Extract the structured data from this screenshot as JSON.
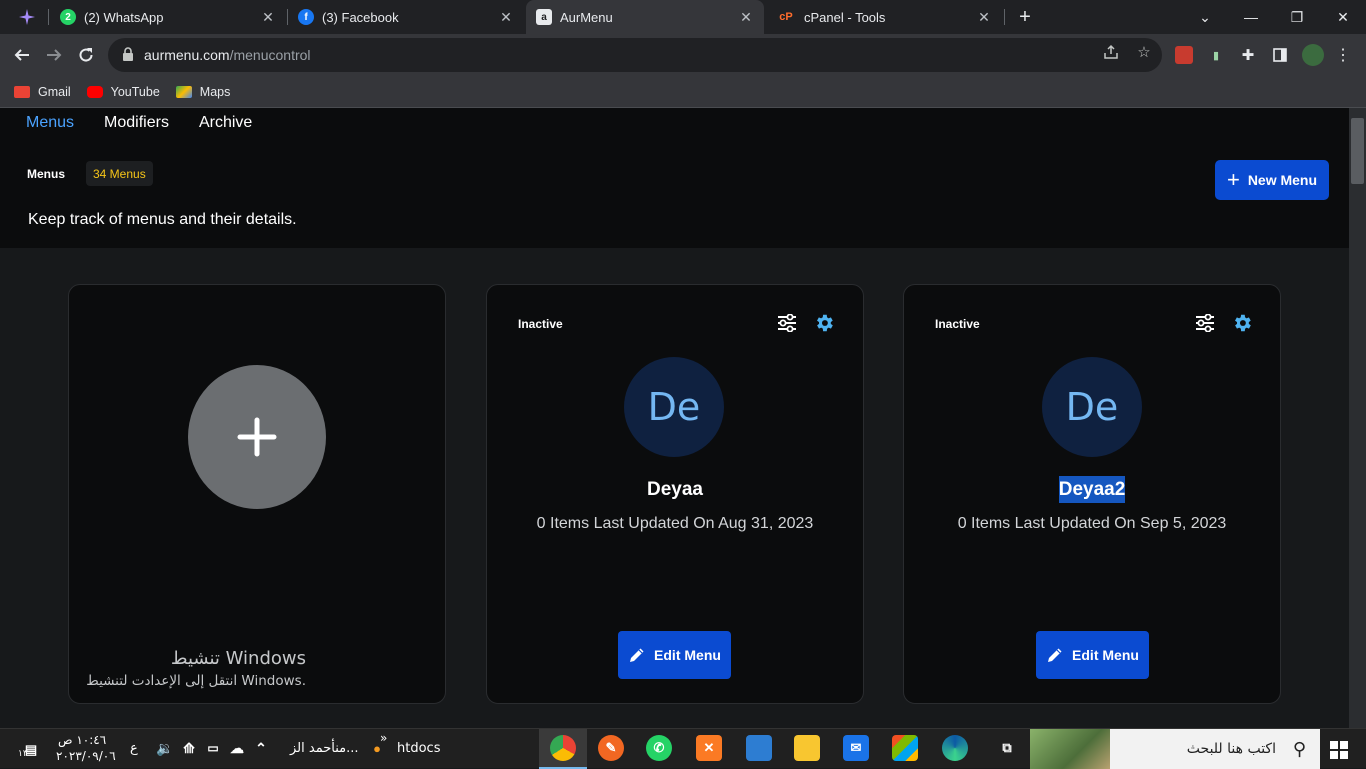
{
  "browser": {
    "tabs": [
      {
        "title": "(2) WhatsApp",
        "color": "#25d366",
        "icon": "whatsapp-icon",
        "badge": "2"
      },
      {
        "title": "(3) Facebook",
        "color": "#1877f2",
        "icon": "facebook-icon",
        "badge": "f"
      },
      {
        "title": "AurMenu",
        "color": "#e8eaed",
        "icon": "aurmenu-icon",
        "badge": "a"
      },
      {
        "title": "cPanel - Tools",
        "color": "#ff6c2c",
        "icon": "cpanel-icon",
        "badge": "cP"
      }
    ],
    "url_host": "aurmenu.com",
    "url_path": "/menucontrol",
    "bookmarks": [
      {
        "label": "Gmail",
        "color": "#ea4335",
        "icon": "gmail-icon"
      },
      {
        "label": "YouTube",
        "color": "#ff0000",
        "icon": "youtube-icon"
      },
      {
        "label": "Maps",
        "color": "#34a853",
        "icon": "maps-icon"
      }
    ]
  },
  "app": {
    "nav": {
      "menus": "Menus",
      "modifiers": "Modifiers",
      "archive": "Archive"
    },
    "menus_label": "Menus",
    "menus_count": "34 Menus",
    "tagline": "Keep track of menus and their details.",
    "new_menu": "New Menu",
    "accent": "#4ba3ff",
    "primary": "#0b4bd1",
    "cards": [
      {
        "status": "Inactive",
        "initials": "De",
        "name": "Deyaa",
        "meta": "0 Items Last Updated On Aug 31, 2023",
        "edit": "Edit Menu"
      },
      {
        "status": "Inactive",
        "initials": "De",
        "name": "Deyaa2",
        "meta": "0 Items Last Updated On Sep 5, 2023",
        "edit": "Edit Menu"
      }
    ]
  },
  "watermark": {
    "line1": "تنشيط Windows",
    "line2": "انتقل إلى الإعدادت لتنشيط Windows."
  },
  "taskbar": {
    "search_placeholder": "اكتب هنا للبحث",
    "htdocs": "htdocs",
    "user_window": "منأحمد الز...",
    "time": "١٠:٤٦ ص",
    "date": "٢٠٢٣/٠٩/٠٦",
    "lang": "ع",
    "notif_count": "١٣"
  }
}
